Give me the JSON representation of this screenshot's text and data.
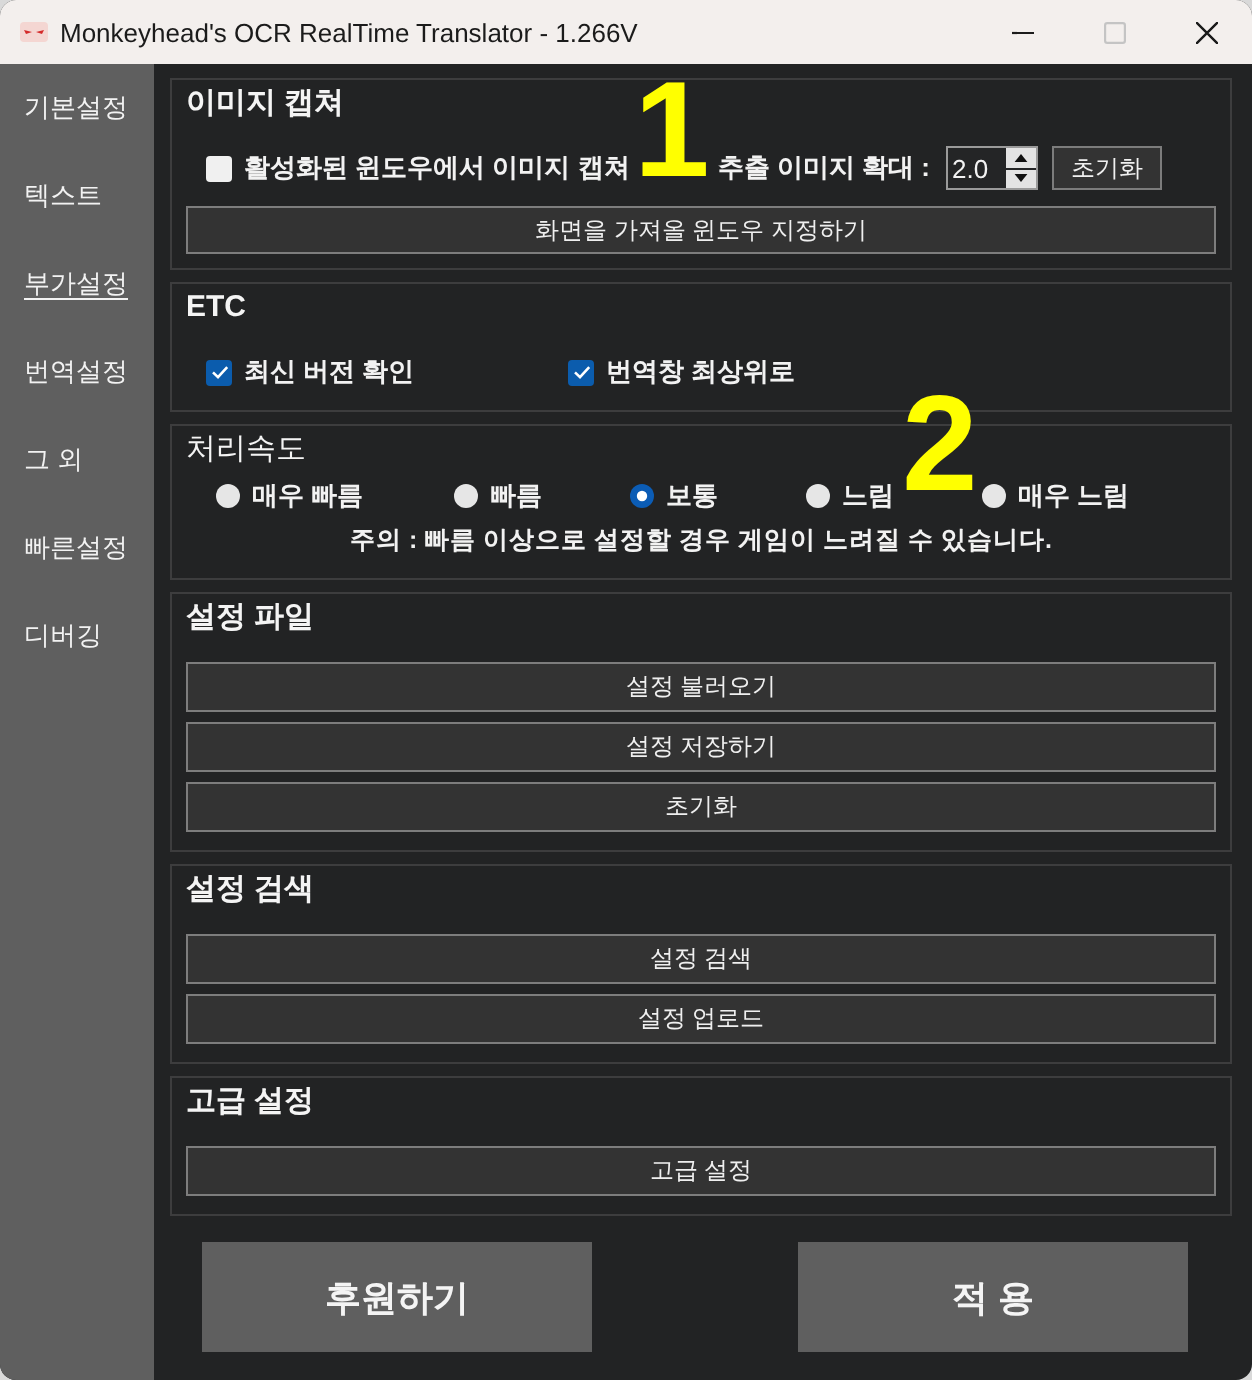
{
  "window": {
    "title": "Monkeyhead's OCR RealTime Translator - 1.266V",
    "controls": [
      {
        "kind": "minimize",
        "disabled": false
      },
      {
        "kind": "maximize",
        "disabled": true
      },
      {
        "kind": "close",
        "disabled": false
      }
    ]
  },
  "sidebar": {
    "items": [
      {
        "label": "기본설정",
        "selected": false
      },
      {
        "label": "텍스트",
        "selected": false
      },
      {
        "label": "부가설정",
        "selected": true
      },
      {
        "label": "번역설정",
        "selected": false
      },
      {
        "label": "그 외",
        "selected": false
      },
      {
        "label": "빠른설정",
        "selected": false
      },
      {
        "label": "디버깅",
        "selected": false
      }
    ]
  },
  "sections": [
    {
      "kind": "capture",
      "title": "이미지 캡쳐",
      "checkbox": {
        "label": "활성화된 윈도우에서 이미지 캡쳐",
        "checked": false
      },
      "scale_label": "추출 이미지 확대 :",
      "scale_value": "2.0",
      "reset_button": "초기화",
      "buttons": [
        "화면을 가져올 윈도우 지정하기"
      ]
    },
    {
      "kind": "checks",
      "title": "ETC",
      "checkboxes": [
        {
          "label": "최신 버전 확인",
          "checked": true
        },
        {
          "label": "번역창 최상위로",
          "checked": true
        }
      ]
    },
    {
      "kind": "radios",
      "title": "처리속도",
      "options": [
        {
          "label": "매우 빠름",
          "selected": false
        },
        {
          "label": "빠름",
          "selected": false
        },
        {
          "label": "보통",
          "selected": true
        },
        {
          "label": "느림",
          "selected": false
        },
        {
          "label": "매우 느림",
          "selected": false
        }
      ],
      "note": "주의 : 빠름 이상으로 설정할 경우 게임이 느려질 수 있습니다."
    },
    {
      "kind": "buttons",
      "title": "설정 파일",
      "buttons": [
        "설정 불러오기",
        "설정 저장하기",
        "초기화"
      ]
    },
    {
      "kind": "buttons",
      "title": "설정 검색",
      "buttons": [
        "설정 검색",
        "설정 업로드"
      ]
    },
    {
      "kind": "buttons",
      "title": "고급 설정",
      "buttons": [
        "고급 설정"
      ]
    }
  ],
  "footer_buttons": [
    "후원하기",
    "적 용"
  ],
  "annotations": [
    {
      "label": "1"
    },
    {
      "label": "2"
    }
  ]
}
